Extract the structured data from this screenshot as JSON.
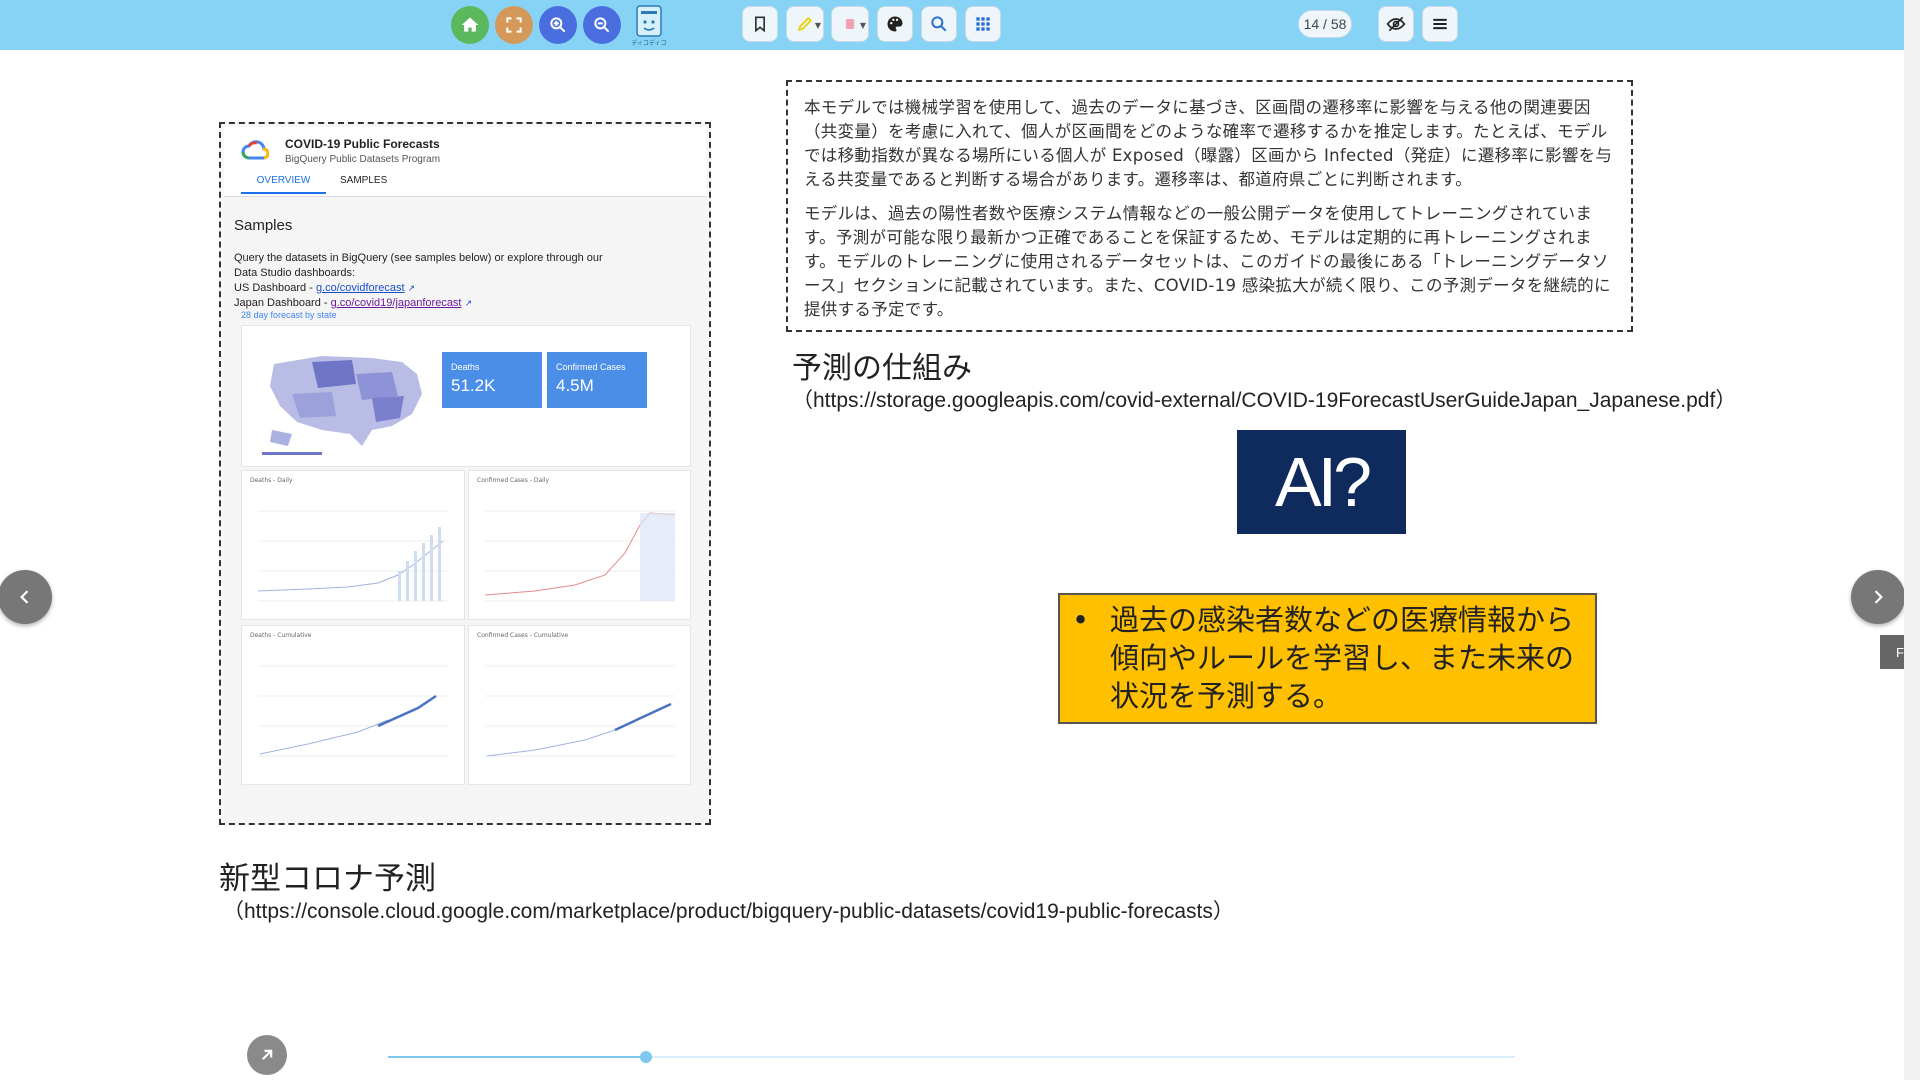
{
  "toolbar": {
    "logo_text": "ディコディコ",
    "page_current": 14,
    "page_total": 58,
    "page_counter": "14 / 58",
    "icons": [
      "home-icon",
      "fullscreen-icon",
      "zoom-in-icon",
      "zoom-out-icon",
      "app-logo",
      "bookmark-icon",
      "highlighter-icon",
      "eraser-icon",
      "palette-icon",
      "search-icon",
      "grid-icon",
      "hide-icon",
      "menu-icon"
    ],
    "colors": {
      "bar": "#87d3f5",
      "home": "#5cb85c",
      "fullscreen": "#d4995a",
      "zoom": "#4a6ee0"
    }
  },
  "screenshot": {
    "title": "COVID-19 Public Forecasts",
    "subtitle": "BigQuery Public Datasets Program",
    "tabs": [
      "OVERVIEW",
      "SAMPLES"
    ],
    "active_tab": "OVERVIEW",
    "heading": "Samples",
    "body_line1": "Query the datasets in BigQuery (see samples below) or explore through our",
    "body_line2": "Data Studio dashboards:",
    "us_label": "US Dashboard - ",
    "us_link": "g.co/covidforecast",
    "jp_label": "Japan Dashboard - ",
    "jp_link": "g.co/covid19/japanforecast",
    "forecast_link": "28 day forecast by state",
    "kpis": [
      {
        "label": "Deaths",
        "value": "51.2K"
      },
      {
        "label": "Confirmed Cases",
        "value": "4.5M"
      }
    ],
    "panel_titles": [
      "Deaths - Daily",
      "Confirmed Cases - Daily",
      "Deaths - Cumulative",
      "Confirmed Cases - Cumulative"
    ]
  },
  "textbox": {
    "para1": "本モデルでは機械学習を使用して、過去のデータに基づき、区画間の遷移率に影響を与える他の関連要因（共変量）を考慮に入れて、個人が区画間をどのような確率で遷移するかを推定します。たとえば、モデルでは移動指数が異なる場所にいる個人が Exposed（曝露）区画から Infected（発症）に遷移率に影響を与える共変量であると判断する場合があります。遷移率は、都道府県ごとに判断されます。",
    "para2": "モデルは、過去の陽性者数や医療システム情報などの一般公開データを使用してトレーニングされています。予測が可能な限り最新かつ正確であることを保証するため、モデルは定期的に再トレーニングされます。モデルのトレーニングに使用されるデータセットは、このガイドの最後にある「トレーニングデータソース」セクションに記載されています。また、COVID-19 感染拡大が続く限り、この予測データを継続的に提供する予定です。"
  },
  "right": {
    "heading": "予測の仕組み",
    "url": "（https://storage.googleapis.com/covid-external/COVID-19ForecastUserGuideJapan_Japanese.pdf）",
    "ai_logo_text": "AI?",
    "note_bullet": "•",
    "note_text": "過去の感染者数などの医療情報から傾向やルールを学習し、また未来の状況を予測する。"
  },
  "left": {
    "heading": "新型コロナ予測",
    "url": "（https://console.cloud.google.com/marketplace/product/bigquery-public-datasets/covid19-public-forecasts）"
  },
  "nav": {
    "side_tab_label": "F",
    "progress_fraction": 0.229
  }
}
